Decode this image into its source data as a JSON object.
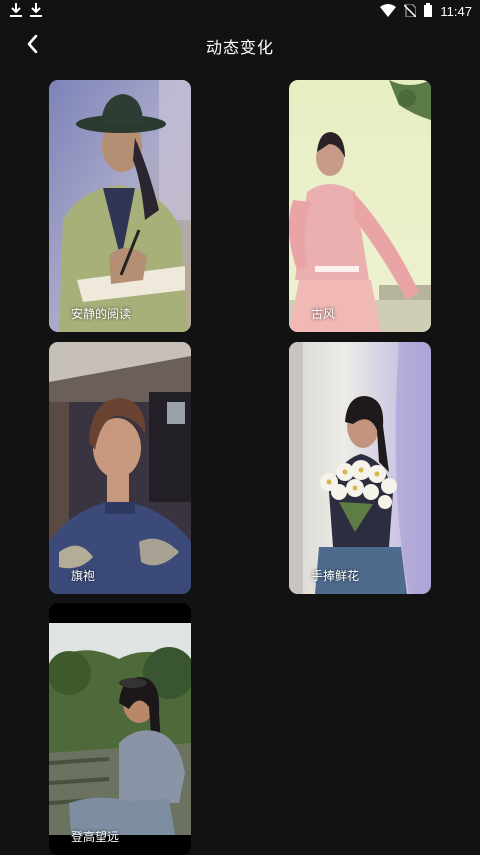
{
  "status_bar": {
    "time": "11:47",
    "left_icons": [
      "download-icon",
      "download-icon"
    ],
    "right_icons": [
      "wifi-icon",
      "no-sim-icon",
      "battery-icon"
    ]
  },
  "header": {
    "title": "动态变化",
    "back_icon": "chevron-left-icon"
  },
  "gallery": {
    "items": [
      {
        "label": "安静的阅读"
      },
      {
        "label": "古风"
      },
      {
        "label": "旗袍"
      },
      {
        "label": "手捧鲜花"
      },
      {
        "label": "登高望远"
      }
    ]
  },
  "colors": {
    "background": "#121212",
    "text": "#ffffff"
  }
}
